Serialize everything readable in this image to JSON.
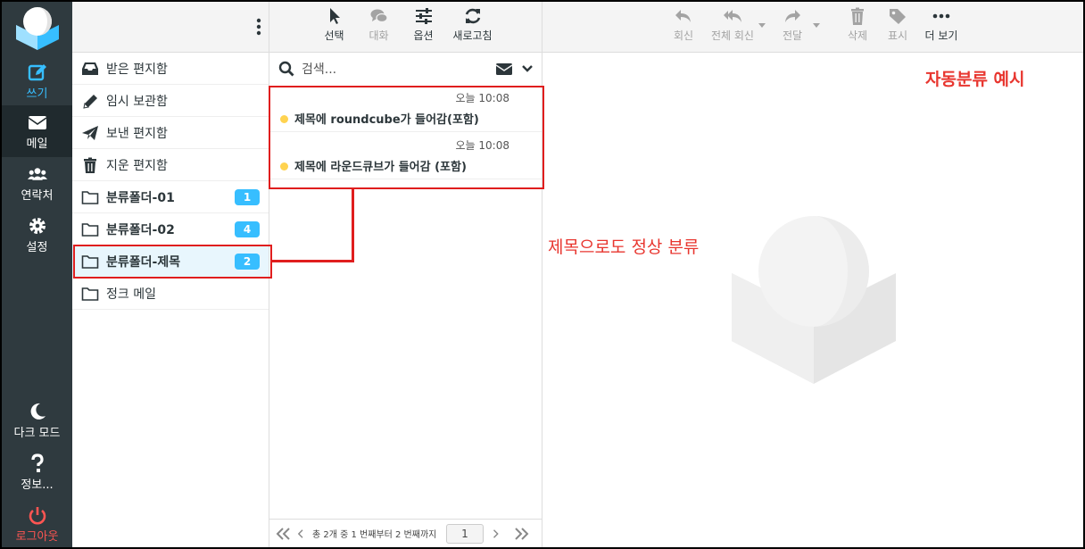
{
  "nav": {
    "compose": "쓰기",
    "mail": "메일",
    "contacts": "연락처",
    "settings": "설정",
    "dark_mode": "다크 모드",
    "about": "정보...",
    "logout": "로그아웃"
  },
  "folders": [
    {
      "label": "받은 편지함",
      "icon": "inbox-icon",
      "count": ""
    },
    {
      "label": "임시 보관함",
      "icon": "pencil-icon",
      "count": ""
    },
    {
      "label": "보낸 편지함",
      "icon": "paper-plane-icon",
      "count": ""
    },
    {
      "label": "지운 편지함",
      "icon": "trash-icon",
      "count": ""
    },
    {
      "label": "분류폴더-01",
      "icon": "folder-icon",
      "count": "1"
    },
    {
      "label": "분류폴더-02",
      "icon": "folder-icon",
      "count": "4"
    },
    {
      "label": "분류폴더-제목",
      "icon": "folder-icon",
      "count": "2"
    },
    {
      "label": "정크 메일",
      "icon": "folder-icon",
      "count": ""
    }
  ],
  "list_toolbar": {
    "select": "선택",
    "threads": "대화",
    "options": "옵션",
    "refresh": "새로고침"
  },
  "search": {
    "placeholder": "검색..."
  },
  "messages": [
    {
      "time": "오늘 10:08",
      "subject": "제목에 roundcube가 들어감(포함)"
    },
    {
      "time": "오늘 10:08",
      "subject": "제목에 라운드큐브가 들어감 (포함)"
    }
  ],
  "pager": {
    "info": "총 2개 중 1 번째부터 2 번째까지",
    "page": "1"
  },
  "content_toolbar": {
    "reply": "회신",
    "reply_all": "전체 회신",
    "forward": "전달",
    "delete": "삭제",
    "mark": "표시",
    "more": "더 보기"
  },
  "annotations": {
    "title": "자동분류 예시",
    "note": "제목으로도 정상 분류"
  },
  "colors": {
    "accent": "#37beff",
    "annotation": "#e01e1e",
    "unread_dot": "#ffd350"
  }
}
